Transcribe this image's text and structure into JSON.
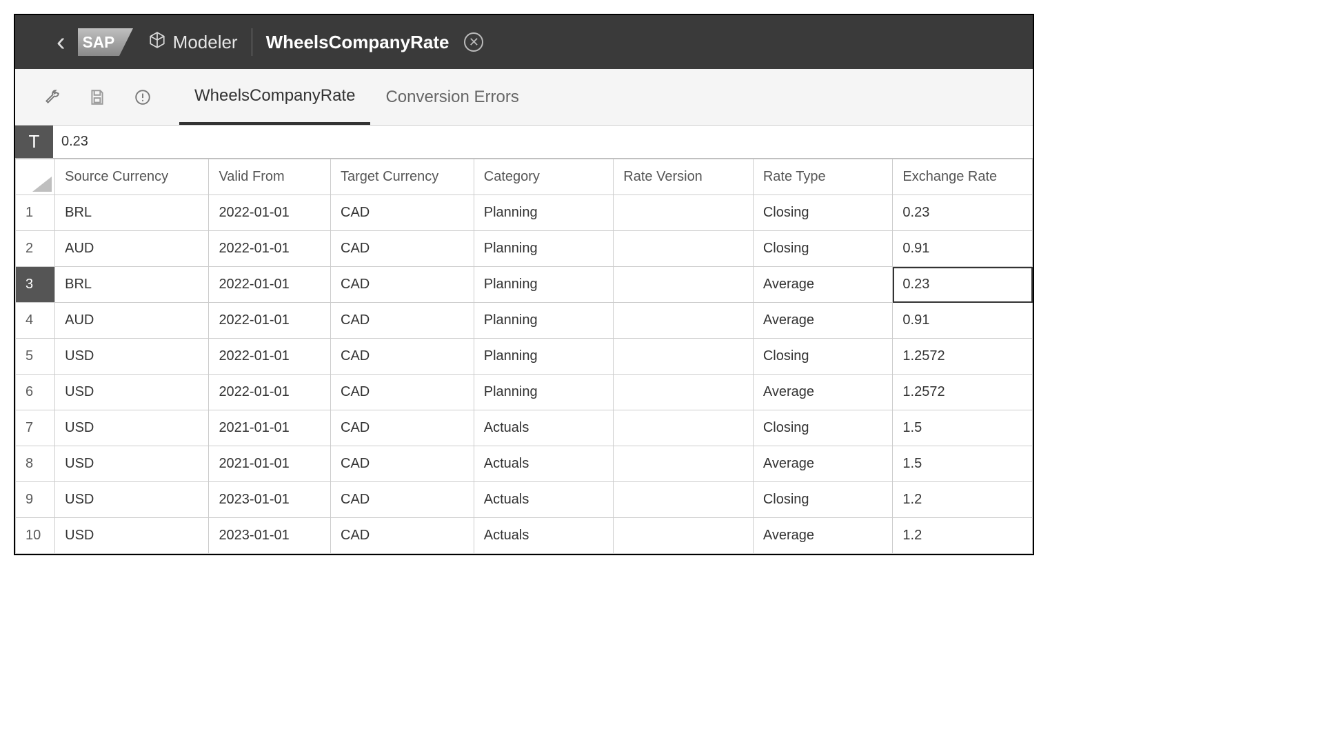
{
  "shell": {
    "modeler_label": "Modeler",
    "title": "WheelsCompanyRate"
  },
  "tabs": [
    {
      "label": "WheelsCompanyRate",
      "active": true
    },
    {
      "label": "Conversion Errors",
      "active": false
    }
  ],
  "formula": {
    "type_indicator": "T",
    "value": "0.23"
  },
  "table": {
    "selected_row": 3,
    "selected_col": 6,
    "columns": [
      "Source Currency",
      "Valid From",
      "Target Currency",
      "Category",
      "Rate Version",
      "Rate Type",
      "Exchange Rate"
    ],
    "rows": [
      {
        "n": 1,
        "cells": [
          "BRL",
          "2022-01-01",
          "CAD",
          "Planning",
          "",
          "Closing",
          "0.23"
        ]
      },
      {
        "n": 2,
        "cells": [
          "AUD",
          "2022-01-01",
          "CAD",
          "Planning",
          "",
          "Closing",
          "0.91"
        ]
      },
      {
        "n": 3,
        "cells": [
          "BRL",
          "2022-01-01",
          "CAD",
          "Planning",
          "",
          "Average",
          "0.23"
        ]
      },
      {
        "n": 4,
        "cells": [
          "AUD",
          "2022-01-01",
          "CAD",
          "Planning",
          "",
          "Average",
          "0.91"
        ]
      },
      {
        "n": 5,
        "cells": [
          "USD",
          "2022-01-01",
          "CAD",
          "Planning",
          "",
          "Closing",
          "1.2572"
        ]
      },
      {
        "n": 6,
        "cells": [
          "USD",
          "2022-01-01",
          "CAD",
          "Planning",
          "",
          "Average",
          "1.2572"
        ]
      },
      {
        "n": 7,
        "cells": [
          "USD",
          "2021-01-01",
          "CAD",
          "Actuals",
          "",
          "Closing",
          "1.5"
        ]
      },
      {
        "n": 8,
        "cells": [
          "USD",
          "2021-01-01",
          "CAD",
          "Actuals",
          "",
          "Average",
          "1.5"
        ]
      },
      {
        "n": 9,
        "cells": [
          "USD",
          "2023-01-01",
          "CAD",
          "Actuals",
          "",
          "Closing",
          "1.2"
        ]
      },
      {
        "n": 10,
        "cells": [
          "USD",
          "2023-01-01",
          "CAD",
          "Actuals",
          "",
          "Average",
          "1.2"
        ]
      }
    ]
  }
}
